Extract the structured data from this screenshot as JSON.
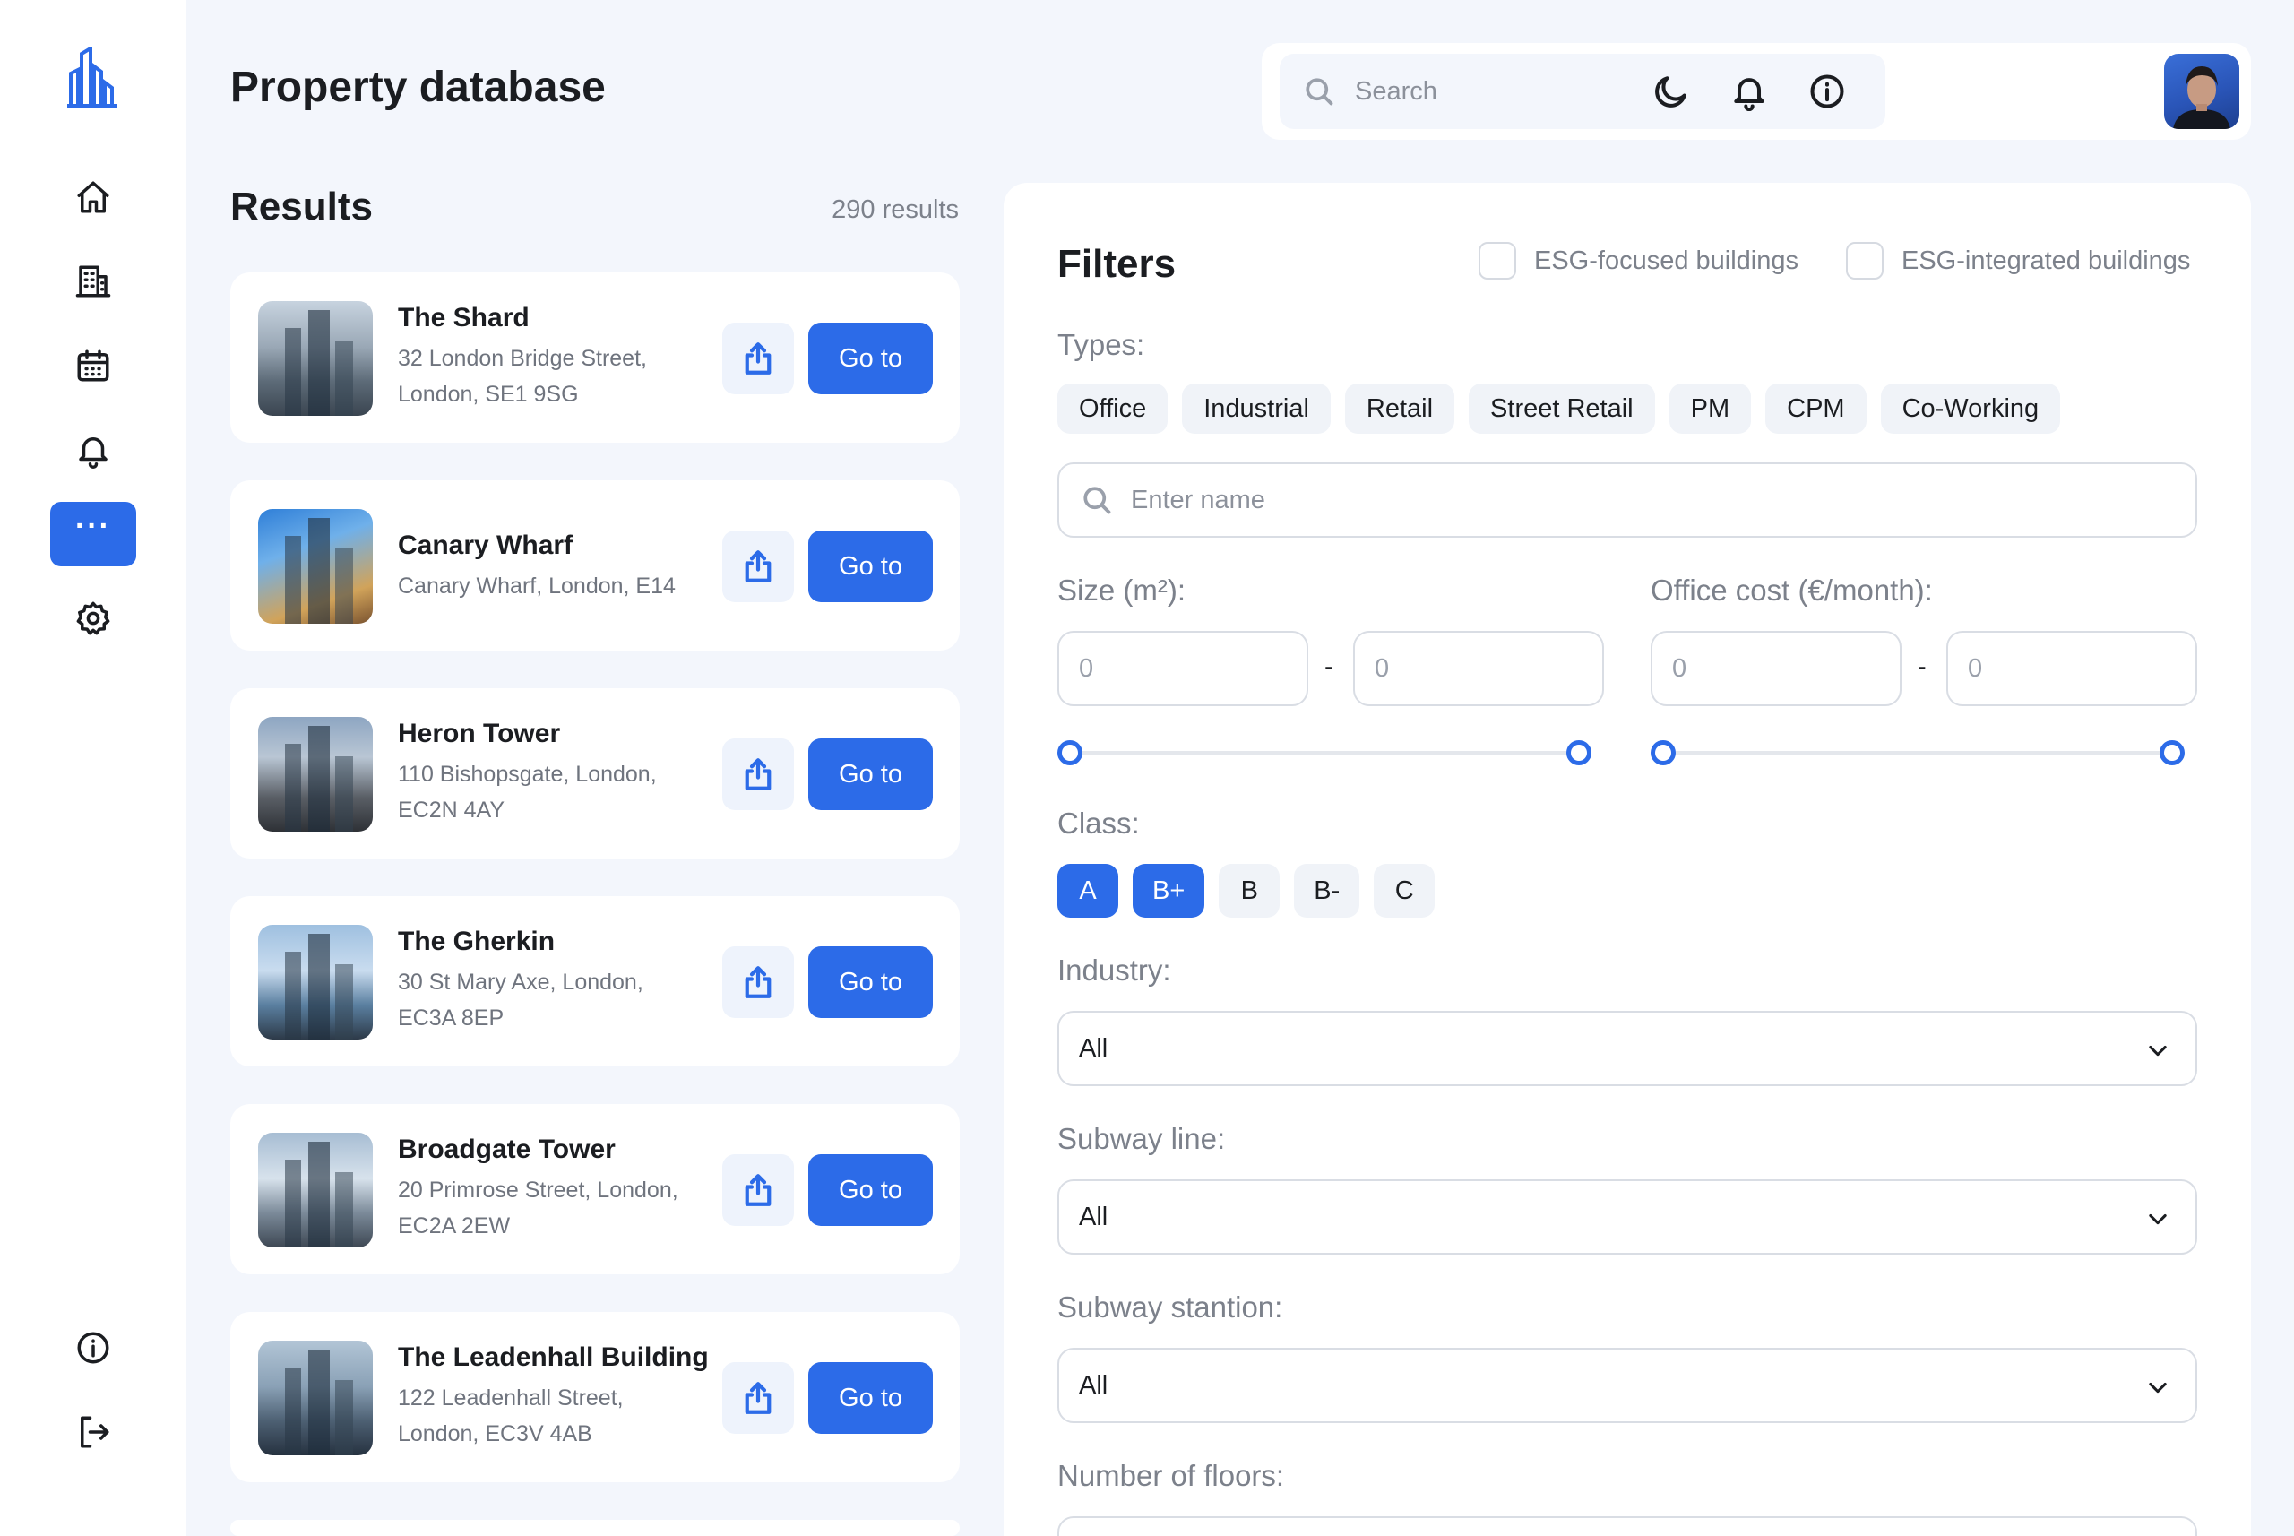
{
  "header": {
    "title": "Property database"
  },
  "search": {
    "placeholder": "Search"
  },
  "sidebar": {
    "items": [
      {
        "name": "home-icon"
      },
      {
        "name": "building-icon"
      },
      {
        "name": "calendar-icon"
      },
      {
        "name": "bell-icon"
      },
      {
        "name": "more-icon",
        "active": true,
        "label": "···"
      },
      {
        "name": "settings-icon"
      }
    ],
    "bottom": [
      {
        "name": "info-icon"
      },
      {
        "name": "logout-icon"
      }
    ]
  },
  "results": {
    "title": "Results",
    "count": "290 results",
    "go_label": "Go to",
    "items": [
      {
        "name": "The Shard",
        "address": "32 London Bridge Street, London, SE1 9SG"
      },
      {
        "name": "Canary Wharf",
        "address": "Canary Wharf, London, E14"
      },
      {
        "name": "Heron Tower",
        "address": "110 Bishopsgate, London, EC2N 4AY"
      },
      {
        "name": "The Gherkin",
        "address": "30 St Mary Axe, London, EC3A 8EP"
      },
      {
        "name": "Broadgate Tower",
        "address": "20 Primrose Street, London, EC2A 2EW"
      },
      {
        "name": "The Leadenhall Building",
        "address": "122 Leadenhall Street, London, EC3V 4AB"
      }
    ]
  },
  "filters": {
    "title": "Filters",
    "esg_focused": "ESG-focused buildings",
    "esg_integrated": "ESG-integrated buildings",
    "types_label": "Types:",
    "types": [
      "Office",
      "Industrial",
      "Retail",
      "Street Retail",
      "PM",
      "CPM",
      "Co-Working"
    ],
    "name_placeholder": "Enter name",
    "size_label": "Size (m²):",
    "cost_label": "Office cost (€/month):",
    "size_min": "0",
    "size_max": "0",
    "cost_min": "0",
    "cost_max": "0",
    "dash": "-",
    "class_label": "Class:",
    "classes": [
      "A",
      "B+",
      "B",
      "B-",
      "C"
    ],
    "classes_selected": [
      "A",
      "B+"
    ],
    "industry_label": "Industry:",
    "industry_value": "All",
    "subway_line_label": "Subway line:",
    "subway_line_value": "All",
    "subway_station_label": "Subway stantion:",
    "subway_station_value": "All",
    "floors_label": "Number of floors:"
  },
  "colors": {
    "accent": "#2c6be8",
    "background": "#f3f6fc"
  }
}
